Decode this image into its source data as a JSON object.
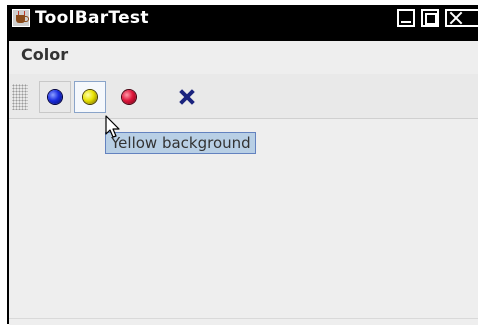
{
  "window": {
    "title": "ToolBarTest"
  },
  "menubar": {
    "items": [
      "Color"
    ]
  },
  "toolbar": {
    "buttons": [
      {
        "name": "blue",
        "color": "#1b2de0"
      },
      {
        "name": "yellow",
        "color": "#e8e200"
      },
      {
        "name": "red",
        "color": "#e0163a"
      },
      {
        "name": "exit",
        "icon": "close-x-icon",
        "color": "#1a237e"
      }
    ]
  },
  "tooltip": {
    "text": "Yellow background"
  }
}
